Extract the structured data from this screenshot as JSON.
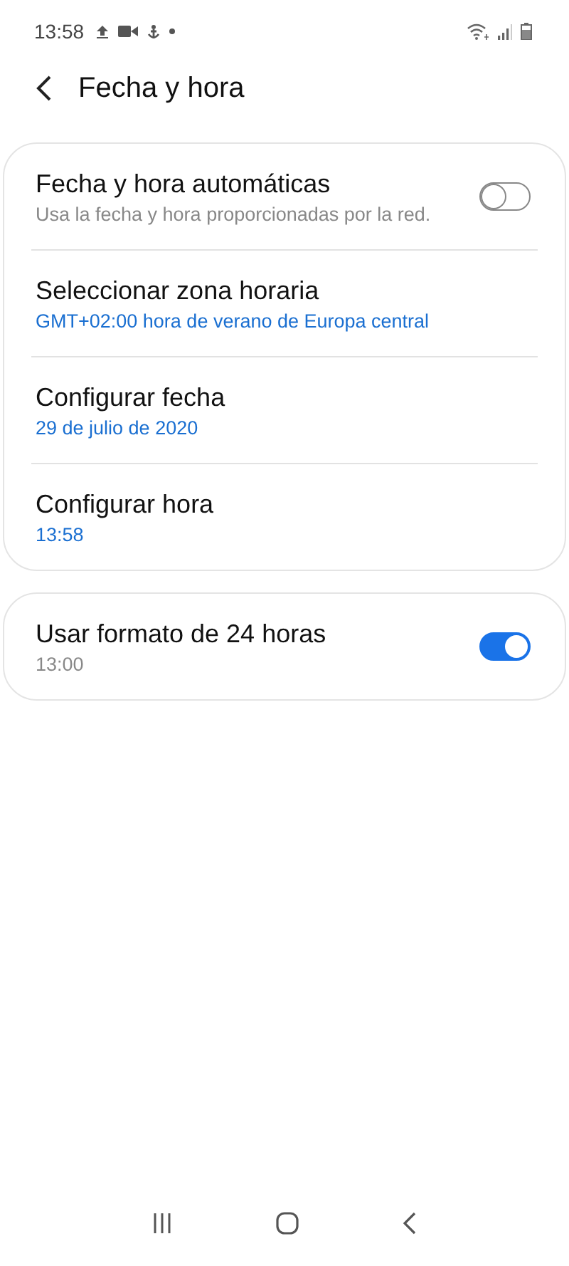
{
  "status_bar": {
    "time": "13:58"
  },
  "header": {
    "title": "Fecha y hora"
  },
  "groups": [
    {
      "items": [
        {
          "kind": "toggle",
          "title": "Fecha y hora automáticas",
          "subtitle": "Usa la fecha y hora proporcionadas por la red.",
          "accent": false,
          "on": false
        },
        {
          "kind": "plain",
          "title": "Seleccionar zona horaria",
          "subtitle": "GMT+02:00 hora de verano de Europa central",
          "accent": true
        },
        {
          "kind": "plain",
          "title": "Configurar fecha",
          "subtitle": "29 de julio de 2020",
          "accent": true
        },
        {
          "kind": "plain",
          "title": "Configurar hora",
          "subtitle": "13:58",
          "accent": true
        }
      ]
    },
    {
      "items": [
        {
          "kind": "toggle",
          "title": "Usar formato de 24 horas",
          "subtitle": "13:00",
          "accent": false,
          "on": true
        }
      ]
    }
  ]
}
